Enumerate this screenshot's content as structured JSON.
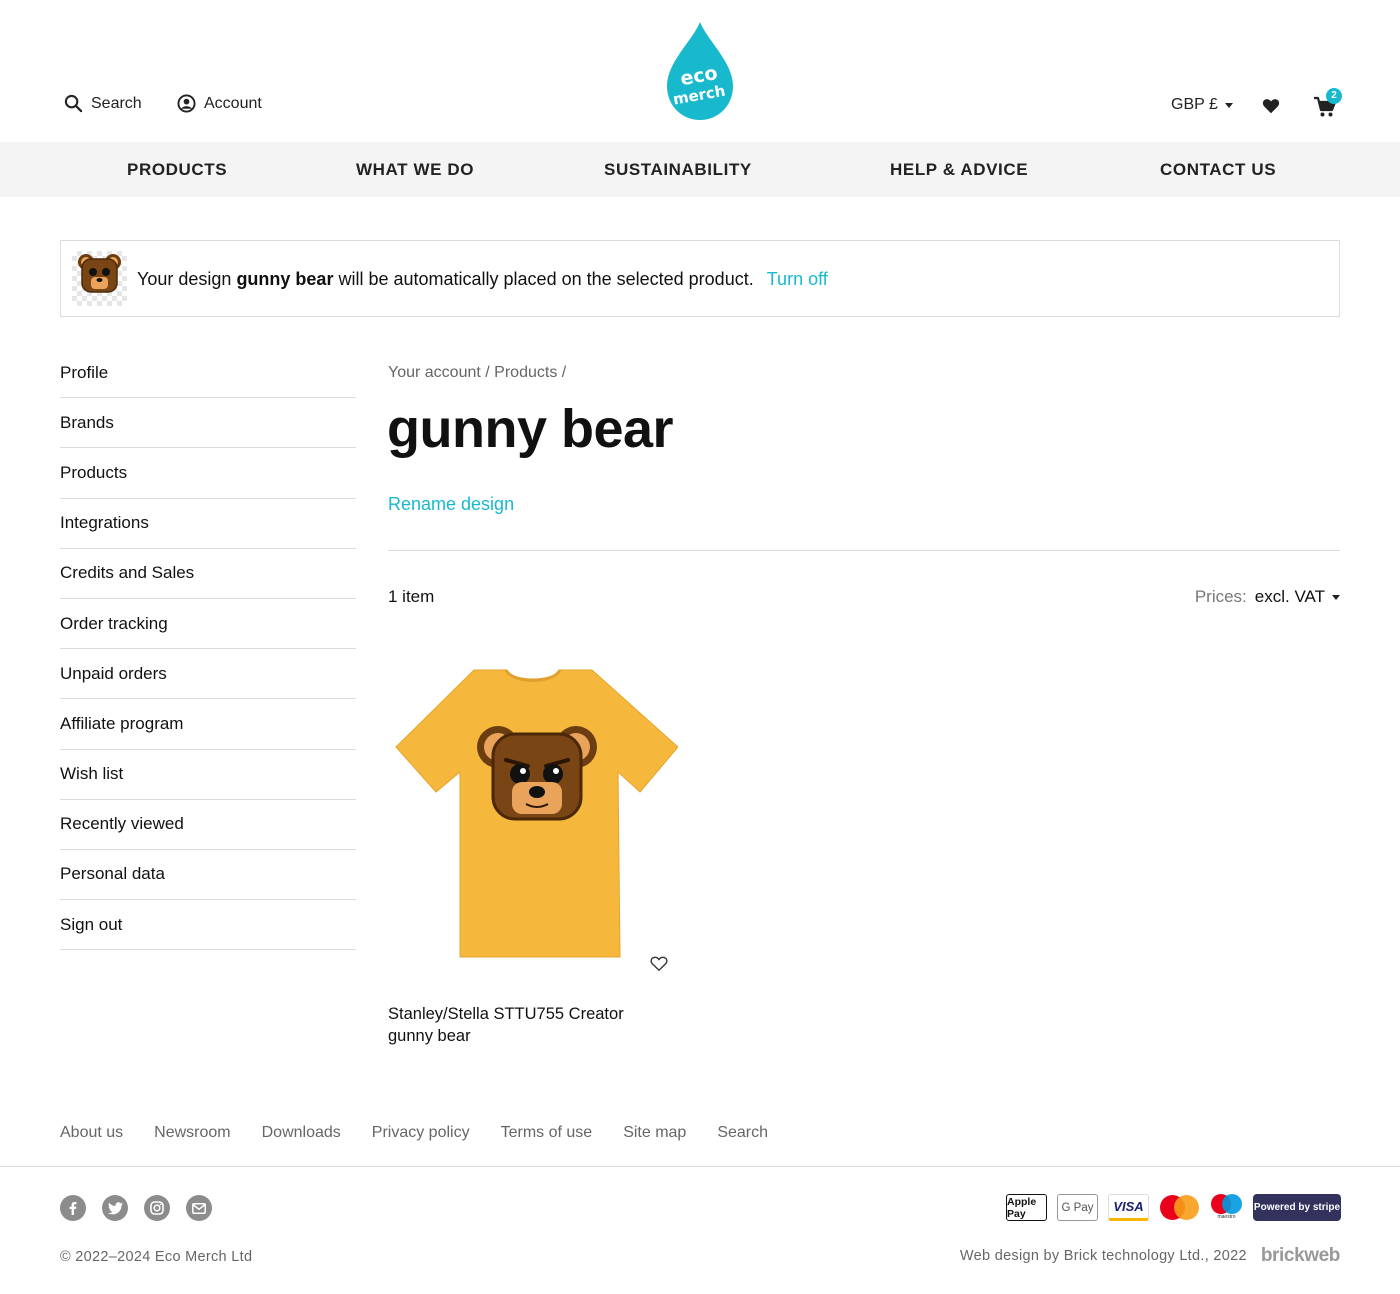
{
  "header": {
    "search_label": "Search",
    "account_label": "Account",
    "logo_text_line1": "eco",
    "logo_text_line2": "merch",
    "currency": "GBP £",
    "cart_count": "2"
  },
  "nav": {
    "items": [
      "PRODUCTS",
      "WHAT WE DO",
      "SUSTAINABILITY",
      "HELP & ADVICE",
      "CONTACT US"
    ]
  },
  "banner": {
    "prefix": "Your design",
    "design_name": "gunny bear",
    "suffix": "will be automatically placed on the selected product.",
    "turn_off": "Turn off"
  },
  "sidebar": {
    "items": [
      "Profile",
      "Brands",
      "Products",
      "Integrations",
      "Credits and Sales",
      "Order tracking",
      "Unpaid orders",
      "Affiliate program",
      "Wish list",
      "Recently viewed",
      "Personal data",
      "Sign out"
    ]
  },
  "main": {
    "breadcrumb": [
      "Your account",
      "Products"
    ],
    "breadcrumb_sep": "/",
    "title": "gunny bear",
    "rename": "Rename design",
    "item_count": "1 item",
    "prices_label": "Prices:",
    "prices_value": "excl. VAT"
  },
  "product": {
    "name_line1": "Stanley/Stella STTU755 Creator",
    "name_line2": "gunny bear",
    "shirt_color": "#f6b83c"
  },
  "footer": {
    "links": [
      "About us",
      "Newsroom",
      "Downloads",
      "Privacy policy",
      "Terms of use",
      "Site map",
      "Search"
    ],
    "social_icons": [
      "facebook-icon",
      "twitter-icon",
      "instagram-icon",
      "email-icon"
    ],
    "payments": [
      "Apple Pay",
      "G Pay",
      "VISA",
      "mastercard",
      "maestro",
      "Powered by stripe"
    ],
    "copyright": "© 2022–2024 Eco Merch Ltd",
    "credit": "Web design by Brick technology Ltd., 2022",
    "credit_brand": "brickweb"
  },
  "colors": {
    "accent": "#18b9cc",
    "nav_bg": "#f4f4f4"
  }
}
